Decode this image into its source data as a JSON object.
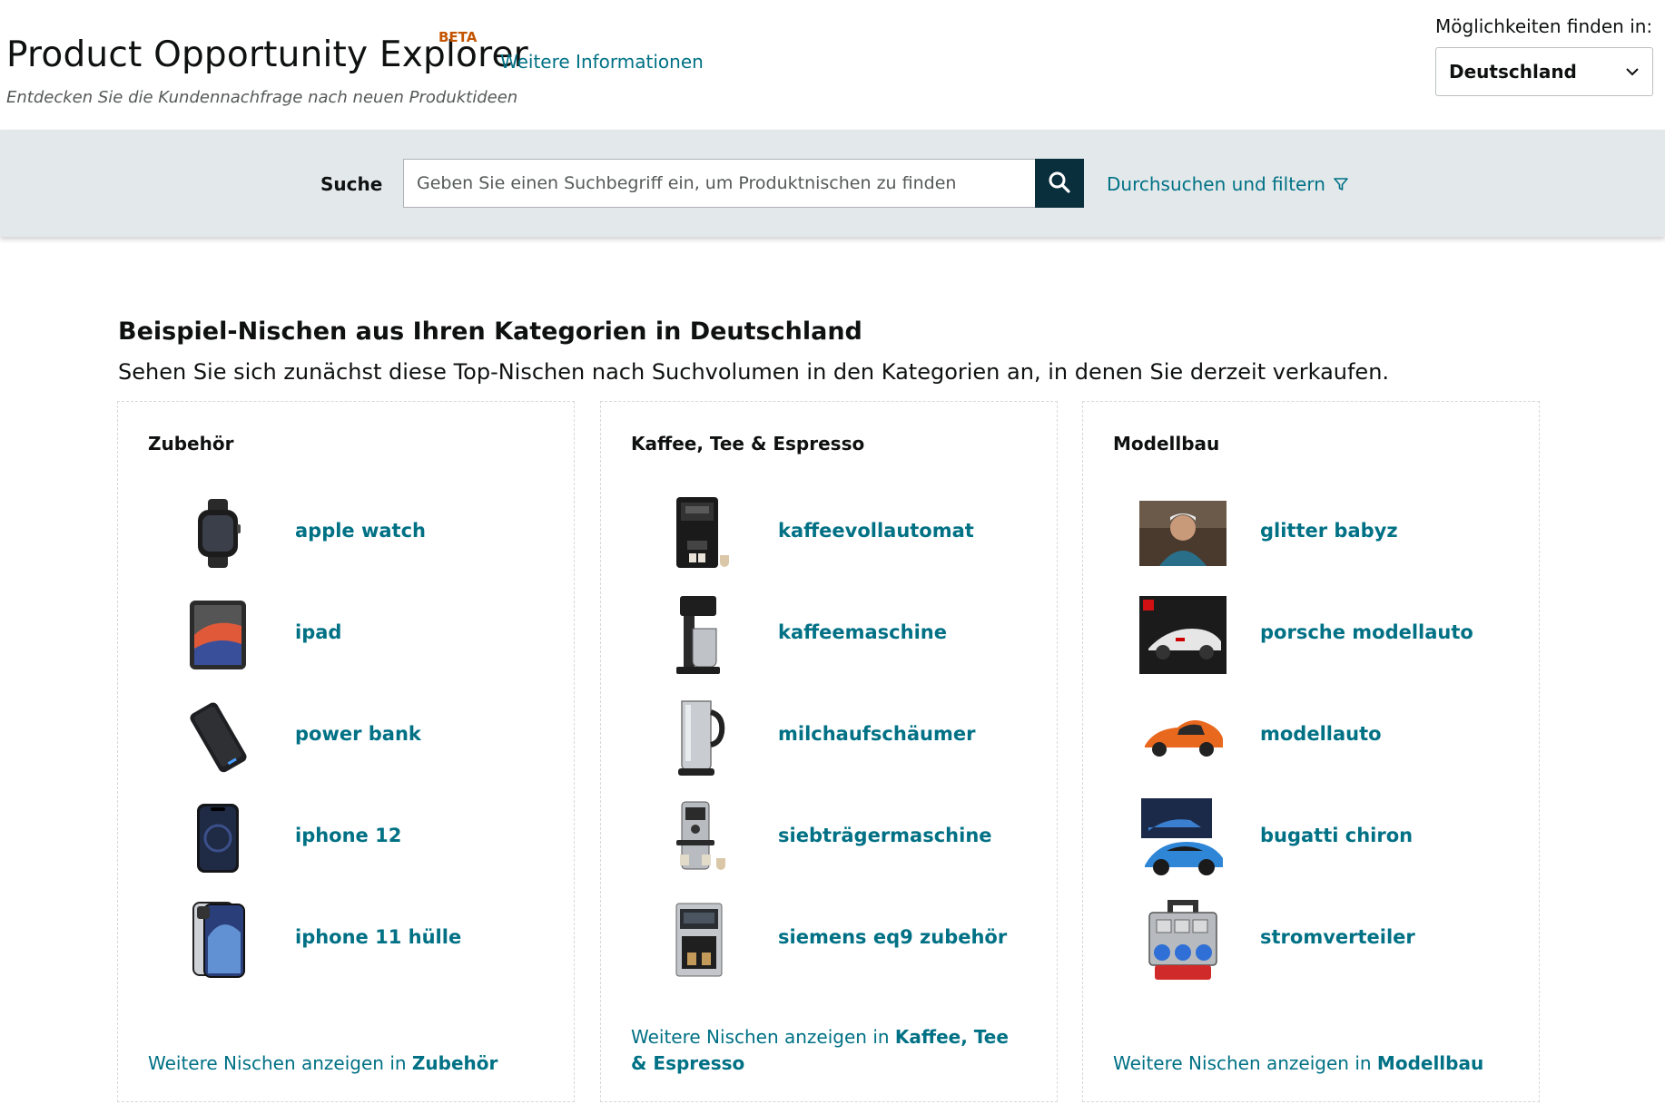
{
  "header": {
    "title": "Product Opportunity Explorer",
    "beta": "BETA",
    "more_info": "Weitere Informationen",
    "subtitle": "Entdecken Sie die Kundennachfrage nach neuen Produktideen",
    "country_label": "Möglichkeiten finden in:",
    "country_value": "Deutschland"
  },
  "search": {
    "label": "Suche",
    "placeholder": "Geben Sie einen Suchbegriff ein, um Produktnischen zu finden",
    "browse_label": "Durchsuchen und filtern"
  },
  "main": {
    "title": "Beispiel-Nischen aus Ihren Kategorien in Deutschland",
    "subtitle": "Sehen Sie sich zunächst diese Top-Nischen nach Suchvolumen in den Kategorien an, in denen Sie derzeit verkaufen.",
    "more_prefix": "Weitere Nischen anzeigen in",
    "categories": [
      {
        "title": "Zubehör",
        "niches": [
          {
            "label": "apple watch",
            "icon": "smartwatch-icon"
          },
          {
            "label": "ipad",
            "icon": "tablet-icon"
          },
          {
            "label": "power bank",
            "icon": "power-bank-icon"
          },
          {
            "label": "iphone 12",
            "icon": "smartphone-icon"
          },
          {
            "label": "iphone 11 hülle",
            "icon": "phone-case-icon"
          }
        ]
      },
      {
        "title": "Kaffee, Tee & Espresso",
        "niches": [
          {
            "label": "kaffeevollautomat",
            "icon": "coffee-machine-icon"
          },
          {
            "label": "kaffeemaschine",
            "icon": "drip-coffee-maker-icon"
          },
          {
            "label": "milchaufschäumer",
            "icon": "milk-frother-icon"
          },
          {
            "label": "siebträgermaschine",
            "icon": "espresso-machine-icon"
          },
          {
            "label": "siemens eq9 zubehör",
            "icon": "coffee-machine-icon"
          }
        ]
      },
      {
        "title": "Modellbau",
        "niches": [
          {
            "label": "glitter babyz",
            "icon": "video-thumbnail-icon"
          },
          {
            "label": "porsche modellauto",
            "icon": "model-car-box-icon"
          },
          {
            "label": "modellauto",
            "icon": "orange-model-car-icon"
          },
          {
            "label": "bugatti chiron",
            "icon": "blue-model-car-icon"
          },
          {
            "label": "stromverteiler",
            "icon": "power-distributor-icon"
          }
        ]
      }
    ]
  },
  "colors": {
    "link": "#007185",
    "beta": "#c45500",
    "search_band": "#e3e9eb",
    "search_button": "#0a2f3c"
  }
}
